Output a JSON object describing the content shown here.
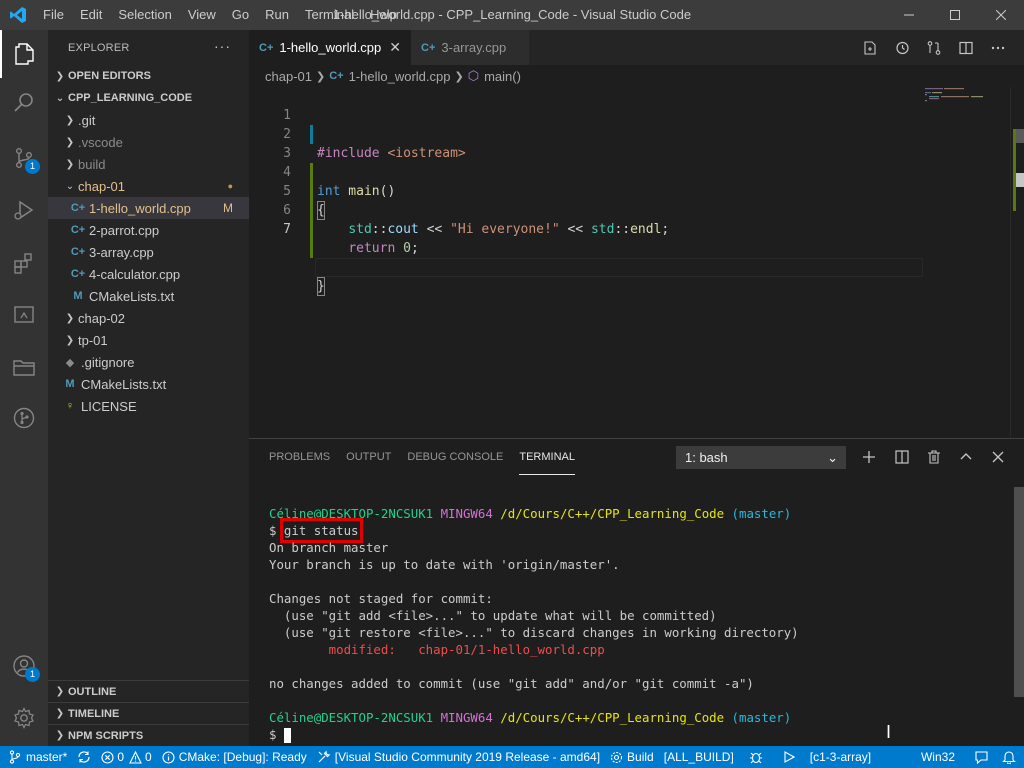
{
  "menu": [
    "File",
    "Edit",
    "Selection",
    "View",
    "Go",
    "Run",
    "Terminal",
    "Help"
  ],
  "window_title": "1-hello_world.cpp - CPP_Learning_Code - Visual Studio Code",
  "activity": {
    "scm_badge": "1",
    "accounts_badge": "1"
  },
  "sidebar": {
    "title": "EXPLORER",
    "more": "···",
    "open_editors": "OPEN EDITORS",
    "root": "CPP_LEARNING_CODE",
    "tree": {
      "git": ".git",
      "vscode": ".vscode",
      "build": "build",
      "chap01": "chap-01",
      "f1": "1-hello_world.cpp",
      "f1_status": "M",
      "f2": "2-parrot.cpp",
      "f3": "3-array.cpp",
      "f4": "4-calculator.cpp",
      "f5": "CMakeLists.txt",
      "chap02": "chap-02",
      "tp01": "tp-01",
      "gitignore": ".gitignore",
      "cmake": "CMakeLists.txt",
      "license": "LICENSE"
    },
    "outline": "OUTLINE",
    "timeline": "TIMELINE",
    "npm": "NPM SCRIPTS"
  },
  "tabs": {
    "active": "1-hello_world.cpp",
    "inactive": "3-array.cpp"
  },
  "breadcrumb": {
    "folder": "chap-01",
    "file": "1-hello_world.cpp",
    "symbol": "main()"
  },
  "code": {
    "line_numbers": [
      "1",
      "2",
      "3",
      "4",
      "5",
      "6",
      "7"
    ],
    "include_kw": "#include",
    "include_arg": " <iostream>",
    "int_kw": "int",
    "main_fn": " main",
    "parens": "()",
    "open_brace": "{",
    "indent": "    ",
    "std1": "std",
    "colons": "::",
    "cout": "cout",
    "shift": " << ",
    "hi": "\"Hi everyone!\"",
    "std2": "std",
    "endl": "endl",
    "semi": ";",
    "return_kw": "return",
    "space": " ",
    "zero": "0",
    "close_brace": "}"
  },
  "panel": {
    "tabs": [
      "PROBLEMS",
      "OUTPUT",
      "DEBUG CONSOLE",
      "TERMINAL"
    ],
    "terminal_select": "1: bash",
    "prompt_user": "Céline@DESKTOP-2NCSUK1",
    "prompt_env": "MINGW64",
    "prompt_path": "/d/Cours/C++/CPP_Learning_Code",
    "prompt_branch": "(master)",
    "dollar": "$ ",
    "command": "git status",
    "out_branch": "On branch master",
    "out_uptodate": "Your branch is up to date with 'origin/master'.",
    "out_changes": "Changes not staged for commit:",
    "out_hint1": "  (use \"git add <file>...\" to update what will be committed)",
    "out_hint2": "  (use \"git restore <file>...\" to discard changes in working directory)",
    "out_modified": "        modified:   chap-01/1-hello_world.cpp",
    "out_nochanges": "no changes added to commit (use \"git add\" and/or \"git commit -a\")"
  },
  "status": {
    "branch": "master*",
    "errors": "0",
    "warnings": "0",
    "cmake": "CMake: [Debug]: Ready",
    "kit": "[Visual Studio Community 2019 Release - amd64]",
    "build": "Build",
    "target": "[ALL_BUILD]",
    "launch": "[c1-3-array]",
    "platform": "Win32"
  },
  "colors": {
    "status_bar": "#007acc",
    "highlight_box": "#e00000",
    "accent": "#007acc"
  }
}
